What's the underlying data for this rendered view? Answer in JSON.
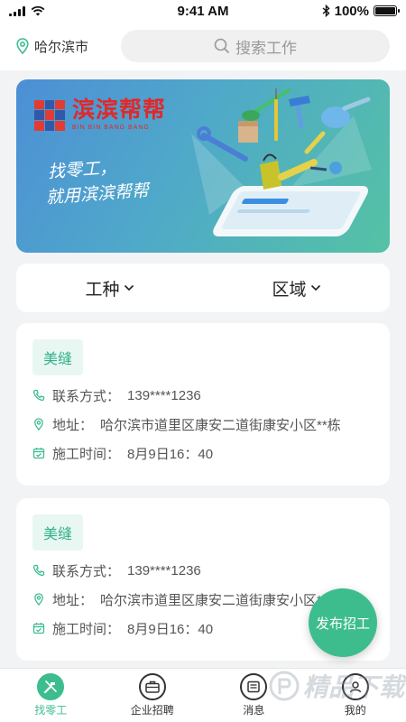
{
  "status_bar": {
    "time": "9:41 AM",
    "battery": "100%",
    "battery_level": 1.0
  },
  "header": {
    "city": "哈尔滨市",
    "search_placeholder": "搜索工作"
  },
  "banner": {
    "brand_name": "滨滨帮帮",
    "brand_sub": "BIN BIN BANG BANG",
    "slogan_line1": "找零工，",
    "slogan_line2": "就用滨滨帮帮"
  },
  "filters": {
    "job_type": "工种",
    "area": "区域"
  },
  "jobs": [
    {
      "tag": "美缝",
      "contact_label": "联系方式：",
      "contact": "139****1236",
      "address_label": "地址：",
      "address": "哈尔滨市道里区康安二道街康安小区**栋",
      "time_label": "施工时间：",
      "time": "8月9日16：40"
    },
    {
      "tag": "美缝",
      "contact_label": "联系方式：",
      "contact": "139****1236",
      "address_label": "地址：",
      "address": "哈尔滨市道里区康安二道街康安小区**栋",
      "time_label": "施工时间：",
      "time": "8月9日16：40"
    }
  ],
  "fab_label": "发布招工",
  "tabs": [
    {
      "label": "找零工",
      "icon": "tools-icon",
      "active": true
    },
    {
      "label": "企业招聘",
      "icon": "briefcase-icon",
      "active": false
    },
    {
      "label": "消息",
      "icon": "message-icon",
      "active": false
    },
    {
      "label": "我的",
      "icon": "user-icon",
      "active": false
    }
  ],
  "watermark": "精品下载",
  "colors": {
    "accent": "#3dbd8e",
    "tag_bg": "#e9f7f3",
    "brand_red": "#e2282a"
  }
}
